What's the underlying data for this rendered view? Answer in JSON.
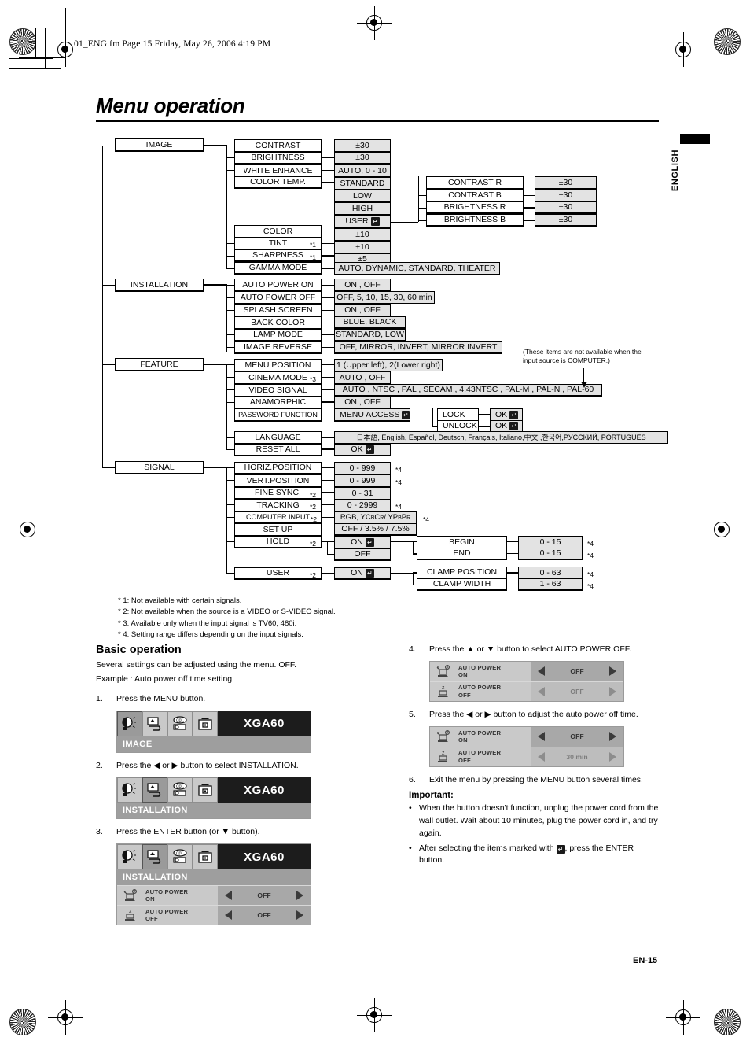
{
  "header": {
    "slug": "01_ENG.fm  Page 15  Friday, May 26, 2006  4:19 PM",
    "title": "Menu operation",
    "side_tab": "ENGLISH",
    "page_number": "EN-15"
  },
  "tree": {
    "roots": [
      "IMAGE",
      "INSTALLATION",
      "FEATURE",
      "SIGNAL"
    ],
    "image": {
      "items": [
        {
          "label": "CONTRAST",
          "value": "±30"
        },
        {
          "label": "BRIGHTNESS",
          "value": "±30"
        },
        {
          "label": "WHITE ENHANCE",
          "value": "AUTO, 0 - 10"
        },
        {
          "label": "COLOR TEMP.",
          "value": "STANDARD"
        },
        {
          "label": "",
          "value": "LOW"
        },
        {
          "label": "",
          "value": "HIGH"
        },
        {
          "label": "",
          "value": "USER"
        },
        {
          "label": "COLOR",
          "value": "±10"
        },
        {
          "label": "TINT",
          "note": "*1",
          "value": "±10"
        },
        {
          "label": "SHARPNESS",
          "note": "*1",
          "value": "±5"
        },
        {
          "label": "GAMMA MODE",
          "value": "AUTO, DYNAMIC, STANDARD, THEATER"
        }
      ],
      "user_sub": [
        {
          "label": "CONTRAST R",
          "value": "±30"
        },
        {
          "label": "CONTRAST B",
          "value": "±30"
        },
        {
          "label": "BRIGHTNESS R",
          "value": "±30"
        },
        {
          "label": "BRIGHTNESS B",
          "value": "±30"
        }
      ]
    },
    "installation": {
      "items": [
        {
          "label": "AUTO POWER ON",
          "value": "ON , OFF"
        },
        {
          "label": "AUTO POWER OFF",
          "value": "OFF,  5,  10,  15,  30,  60 min"
        },
        {
          "label": "SPLASH SCREEN",
          "value": "ON , OFF"
        },
        {
          "label": "BACK COLOR",
          "value": "BLUE, BLACK"
        },
        {
          "label": "LAMP MODE",
          "value": "STANDARD, LOW"
        },
        {
          "label": "IMAGE REVERSE",
          "value": "OFF, MIRROR, INVERT, MIRROR INVERT"
        }
      ]
    },
    "feature": {
      "items": [
        {
          "label": "MENU POSITION",
          "value": "1 (Upper left), 2(Lower right)"
        },
        {
          "label": "CINEMA MODE",
          "note": "*3",
          "value": "AUTO , OFF"
        },
        {
          "label": "VIDEO SIGNAL",
          "value": "AUTO , NTSC , PAL , SECAM , 4.43NTSC , PAL-M , PAL-N , PAL-60"
        },
        {
          "label": "ANAMORPHIC",
          "value": "ON , OFF"
        },
        {
          "label": "PASSWORD FUNCTION",
          "value": "MENU ACCESS"
        },
        {
          "label": "LANGUAGE",
          "value": "日本語, English, Español, Deutsch, Français, Italiano,中文 ,한국어,PУССКИЙ, PORTUGUÊS"
        },
        {
          "label": "RESET ALL",
          "value": "OK"
        }
      ],
      "password_sub": [
        {
          "label": "LOCK",
          "value": "OK"
        },
        {
          "label": "UNLOCK",
          "value": "OK"
        }
      ],
      "note": "(These items are not available when the input source is COMPUTER.)"
    },
    "signal": {
      "items": [
        {
          "label": "HORIZ.POSITION",
          "value": "0 - 999",
          "star": "*4"
        },
        {
          "label": "VERT.POSITION",
          "value": "0 - 999",
          "star": "*4"
        },
        {
          "label": "FINE SYNC.",
          "note": "*2",
          "value": "0 - 31",
          "star": ""
        },
        {
          "label": "TRACKING",
          "note": "*2",
          "value": "0 - 2999",
          "star": "*4"
        },
        {
          "label": "COMPUTER INPUT",
          "note": "*2",
          "value": "RGB, YCBCR / YPBPR",
          "star": "*4"
        },
        {
          "label": "SET UP",
          "value": "OFF / 3.5% / 7.5%",
          "star": ""
        },
        {
          "label": "HOLD",
          "note": "*2",
          "value": "ON",
          "star": ""
        },
        {
          "label": "",
          "value": "OFF",
          "star": ""
        },
        {
          "label": "USER",
          "note": "*2",
          "value": "ON",
          "star": ""
        }
      ],
      "hold_sub": [
        {
          "label": "BEGIN",
          "value": "0 - 15",
          "star": "*4"
        },
        {
          "label": "END",
          "value": "0 - 15",
          "star": "*4"
        }
      ],
      "user_sub": [
        {
          "label": "CLAMP POSITION",
          "value": "0 - 63",
          "star": "*4"
        },
        {
          "label": "CLAMP WIDTH",
          "value": "1 - 63",
          "star": "*4"
        }
      ]
    }
  },
  "footnotes": [
    "* 1: Not available with certain signals.",
    "* 2: Not available when the source is a VIDEO or S-VIDEO signal.",
    "* 3: Available only when the input signal is TV60, 480i.",
    "* 4: Setting range differs depending on the input signals."
  ],
  "basic": {
    "heading": "Basic operation",
    "line1": "Several settings can be adjusted using the menu. OFF.",
    "line2": "Example : Auto power off time setting",
    "step1_num": "1.",
    "step1_text": "Press the MENU button.",
    "step2_num": "2.",
    "step2_text": "Press the ◀ or ▶ button to select INSTALLATION.",
    "step3_num": "3.",
    "step3_text": "Press the ENTER button (or ▼ button).",
    "step4_num": "4.",
    "step4_text": "Press the ▲ or ▼ button to select AUTO POWER OFF.",
    "step5_num": "5.",
    "step5_text": "Press the ◀ or ▶ button to adjust the auto power off time.",
    "step6_num": "6.",
    "step6_text": "Exit the menu by pressing the MENU button several times.",
    "important_heading": "Important:",
    "bullet1": "When the button doesn't function, unplug the power cord from the wall outlet. Wait about 10 minutes, plug the power cord in, and try again.",
    "bullet2_a": "After selecting the items marked with",
    "bullet2_b": ", press the ENTER button."
  },
  "osd": {
    "signal_label": "XGA60",
    "menu_image": "IMAGE",
    "menu_installation": "INSTALLATION",
    "row_apon_l1": "AUTO POWER",
    "row_apon_l2": "ON",
    "row_apoff_l1": "AUTO POWER",
    "row_apoff_l2": "OFF",
    "val_off": "OFF",
    "val_30min": "30 min"
  }
}
